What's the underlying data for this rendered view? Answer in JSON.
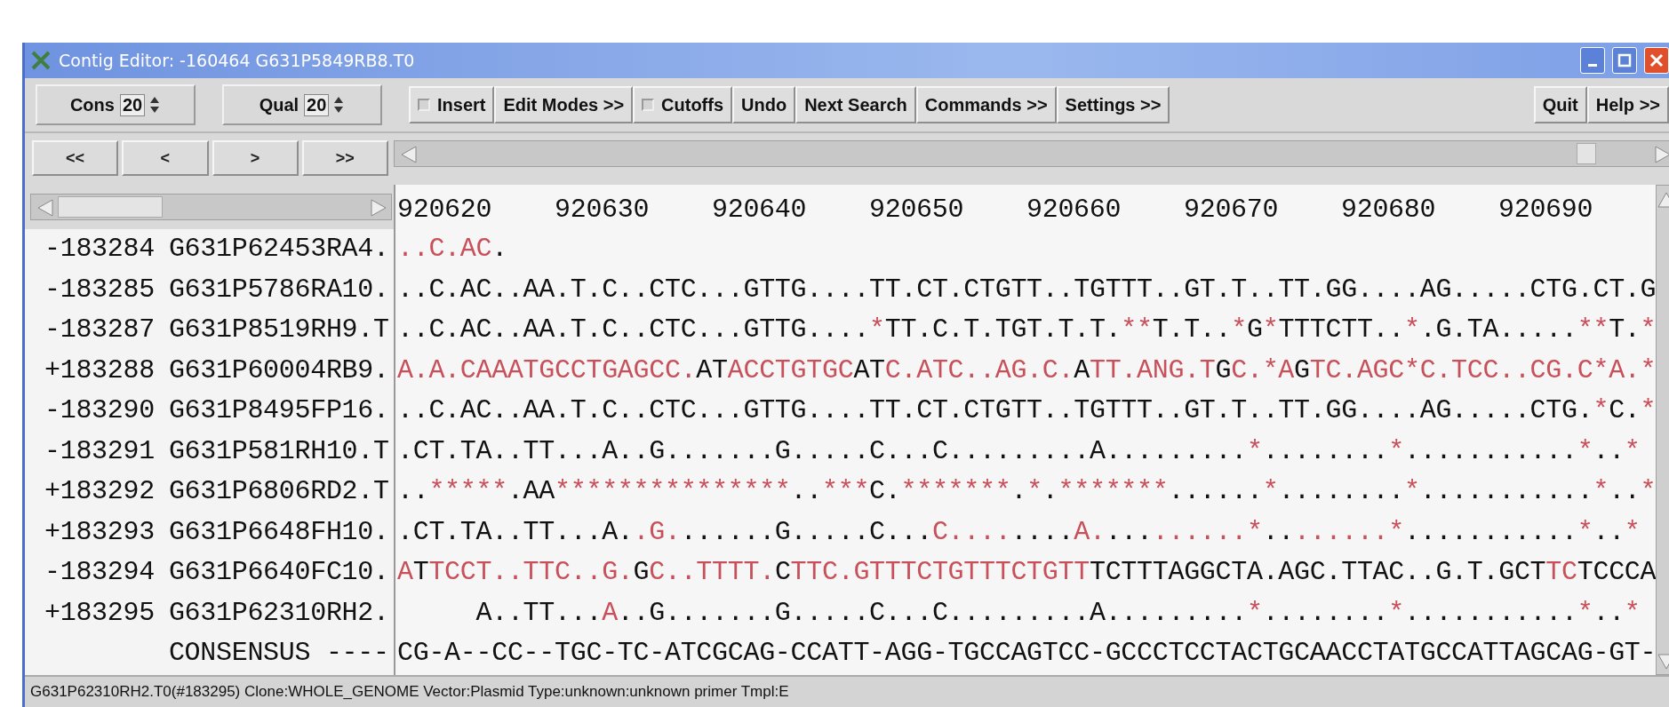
{
  "window": {
    "title": "Contig Editor: -160464 G631P5849RB8.T0"
  },
  "toolbar": {
    "spinners": [
      {
        "label": "Cons",
        "value": "20"
      },
      {
        "label": "Qual",
        "value": "20"
      }
    ],
    "buttons": [
      {
        "kind": "toggle",
        "label": "Insert",
        "checked": false
      },
      {
        "kind": "button",
        "label": "Edit Modes >>"
      },
      {
        "kind": "toggle",
        "label": "Cutoffs",
        "checked": false
      },
      {
        "kind": "button",
        "label": "Undo"
      },
      {
        "kind": "button",
        "label": "Next Search"
      },
      {
        "kind": "button",
        "label": "Commands >>"
      },
      {
        "kind": "button",
        "label": "Settings >>"
      }
    ],
    "right_buttons": [
      "Quit",
      "Help >>"
    ]
  },
  "nav_buttons": [
    "<<",
    "<",
    ">",
    ">>"
  ],
  "ruler": [
    "920620",
    "920630",
    "920640",
    "920650",
    "920660",
    "920670",
    "920680",
    "920690"
  ],
  "readings": [
    {
      "number": "-183284",
      "name": "G631P62453RA4.",
      "segments": [
        {
          "text": "..C.AC",
          "highlight": true
        },
        {
          "text": ".",
          "highlight": false
        }
      ]
    },
    {
      "number": "-183285",
      "name": "G631P5786RA10.",
      "segments": [
        {
          "text": "..C.AC..AA.T.C..CTC...GTTG....TT.CT.CTGTT..TGTTT..GT.T..TT.GG....AG.....CTG.CT.G",
          "highlight": false
        }
      ]
    },
    {
      "number": "-183287",
      "name": "G631P8519RH9.T",
      "segments": [
        {
          "text": "..C.AC..AA.T.C..CTC...GTTG....",
          "highlight": false
        },
        {
          "text": "*",
          "highlight": true
        },
        {
          "text": "TT.C.T.TGT.T.T.",
          "highlight": false
        },
        {
          "text": "**",
          "highlight": true
        },
        {
          "text": "T.T..",
          "highlight": false
        },
        {
          "text": "*",
          "highlight": true
        },
        {
          "text": "G",
          "highlight": false
        },
        {
          "text": "*",
          "highlight": true
        },
        {
          "text": "TTTCTT..",
          "highlight": false
        },
        {
          "text": "*",
          "highlight": true
        },
        {
          "text": ".G.TA.....",
          "highlight": false
        },
        {
          "text": "**",
          "highlight": true
        },
        {
          "text": "T.",
          "highlight": false
        },
        {
          "text": "*",
          "highlight": true
        }
      ]
    },
    {
      "number": "+183288",
      "name": "G631P60004RB9.",
      "segments": [
        {
          "text": "A.A.CAAATGCCTGAGCC.",
          "highlight": true
        },
        {
          "text": "AT",
          "highlight": false
        },
        {
          "text": "ACCTGTGC",
          "highlight": true
        },
        {
          "text": "AT",
          "highlight": false
        },
        {
          "text": "C.ATC..AG.C.",
          "highlight": true
        },
        {
          "text": "A",
          "highlight": false
        },
        {
          "text": "TT.ANG.T",
          "highlight": true
        },
        {
          "text": "G",
          "highlight": false
        },
        {
          "text": "C.*A",
          "highlight": true
        },
        {
          "text": "G",
          "highlight": false
        },
        {
          "text": "TC.AGC*C.TCC..CG.C*A.*",
          "highlight": true
        }
      ]
    },
    {
      "number": "-183290",
      "name": "G631P8495FP16.",
      "segments": [
        {
          "text": "..C.AC..AA.T.C..CTC...GTTG....TT.CT.CTGTT..TGTTT..GT.T..TT.GG....AG.....CTG.",
          "highlight": false
        },
        {
          "text": "*",
          "highlight": true
        },
        {
          "text": "C.",
          "highlight": false
        },
        {
          "text": "*",
          "highlight": true
        }
      ]
    },
    {
      "number": "-183291",
      "name": "G631P581RH10.T",
      "segments": [
        {
          "text": ".CT.TA..TT...A..G.......G.....C...C.........A.........",
          "highlight": false
        },
        {
          "text": "*",
          "highlight": true
        },
        {
          "text": "........",
          "highlight": false
        },
        {
          "text": "*",
          "highlight": true
        },
        {
          "text": "...........",
          "highlight": false
        },
        {
          "text": "*",
          "highlight": true
        },
        {
          "text": "..",
          "highlight": false
        },
        {
          "text": "*",
          "highlight": true
        }
      ]
    },
    {
      "number": "+183292",
      "name": "G631P6806RD2.T",
      "segments": [
        {
          "text": "..",
          "highlight": false
        },
        {
          "text": "*****",
          "highlight": true
        },
        {
          "text": ".AA",
          "highlight": false
        },
        {
          "text": "***************",
          "highlight": true
        },
        {
          "text": "..",
          "highlight": false
        },
        {
          "text": "***",
          "highlight": true
        },
        {
          "text": "C.",
          "highlight": false
        },
        {
          "text": "*******",
          "highlight": true
        },
        {
          "text": ".",
          "highlight": false
        },
        {
          "text": "*",
          "highlight": true
        },
        {
          "text": ".",
          "highlight": false
        },
        {
          "text": "*******",
          "highlight": true
        },
        {
          "text": "......",
          "highlight": false
        },
        {
          "text": "*",
          "highlight": true
        },
        {
          "text": "........",
          "highlight": false
        },
        {
          "text": "*",
          "highlight": true
        },
        {
          "text": "...........",
          "highlight": false
        },
        {
          "text": "*",
          "highlight": true
        },
        {
          "text": "..",
          "highlight": false
        },
        {
          "text": "*",
          "highlight": true
        }
      ]
    },
    {
      "number": "+183293",
      "name": "G631P6648FH10.",
      "segments": [
        {
          "text": ".CT.TA..TT...A.",
          "highlight": false
        },
        {
          "text": ".G.",
          "highlight": true
        },
        {
          "text": "......G.....C...",
          "highlight": false
        },
        {
          "text": "C....",
          "highlight": true
        },
        {
          "text": "....",
          "highlight": false
        },
        {
          "text": "A.",
          "highlight": true
        },
        {
          "text": "...",
          "highlight": false
        },
        {
          "text": "......*",
          "highlight": true
        },
        {
          "text": "..",
          "highlight": false
        },
        {
          "text": "......*",
          "highlight": true
        },
        {
          "text": "...........",
          "highlight": false
        },
        {
          "text": "*",
          "highlight": true
        },
        {
          "text": "..",
          "highlight": false
        },
        {
          "text": "*",
          "highlight": true
        }
      ]
    },
    {
      "number": "-183294",
      "name": "G631P6640FC10.",
      "segments": [
        {
          "text": "A",
          "highlight": true
        },
        {
          "text": "T",
          "highlight": false
        },
        {
          "text": "TCCT..TTC..G.",
          "highlight": true
        },
        {
          "text": "G",
          "highlight": false
        },
        {
          "text": "C..TTTT.",
          "highlight": true
        },
        {
          "text": "C",
          "highlight": false
        },
        {
          "text": "TTC.GTTTCTGTTTCTGTT",
          "highlight": true
        },
        {
          "text": "TCTTTAGGCTA.AGC.TTAC..G.T.GCT",
          "highlight": false
        },
        {
          "text": "TC",
          "highlight": true
        },
        {
          "text": "TCCCA",
          "highlight": false
        }
      ]
    },
    {
      "number": "+183295",
      "name": "G631P62310RH2.",
      "segments": [
        {
          "text": "     A..TT...",
          "highlight": false
        },
        {
          "text": "A",
          "highlight": true
        },
        {
          "text": "..G.......G.....C...C.........A.........",
          "highlight": false
        },
        {
          "text": "*",
          "highlight": true
        },
        {
          "text": "........",
          "highlight": false
        },
        {
          "text": "*",
          "highlight": true
        },
        {
          "text": "...........",
          "highlight": false
        },
        {
          "text": "*",
          "highlight": true
        },
        {
          "text": "..",
          "highlight": false
        },
        {
          "text": "*",
          "highlight": true
        }
      ]
    }
  ],
  "consensus": {
    "name": "CONSENSUS ----",
    "sequence": "CG-A--CC--TGC-TC-ATCGCAG-CCATT-AGG-TGCCAGTCC-GCCCTCCTACTGCAACCTATGCCATTAGCAG-GT-"
  },
  "status_bar": "G631P62310RH2.T0(#183295) Clone:WHOLE_GENOME Vector:Plasmid Type:unknown:unknown primer Tmpl:E"
}
